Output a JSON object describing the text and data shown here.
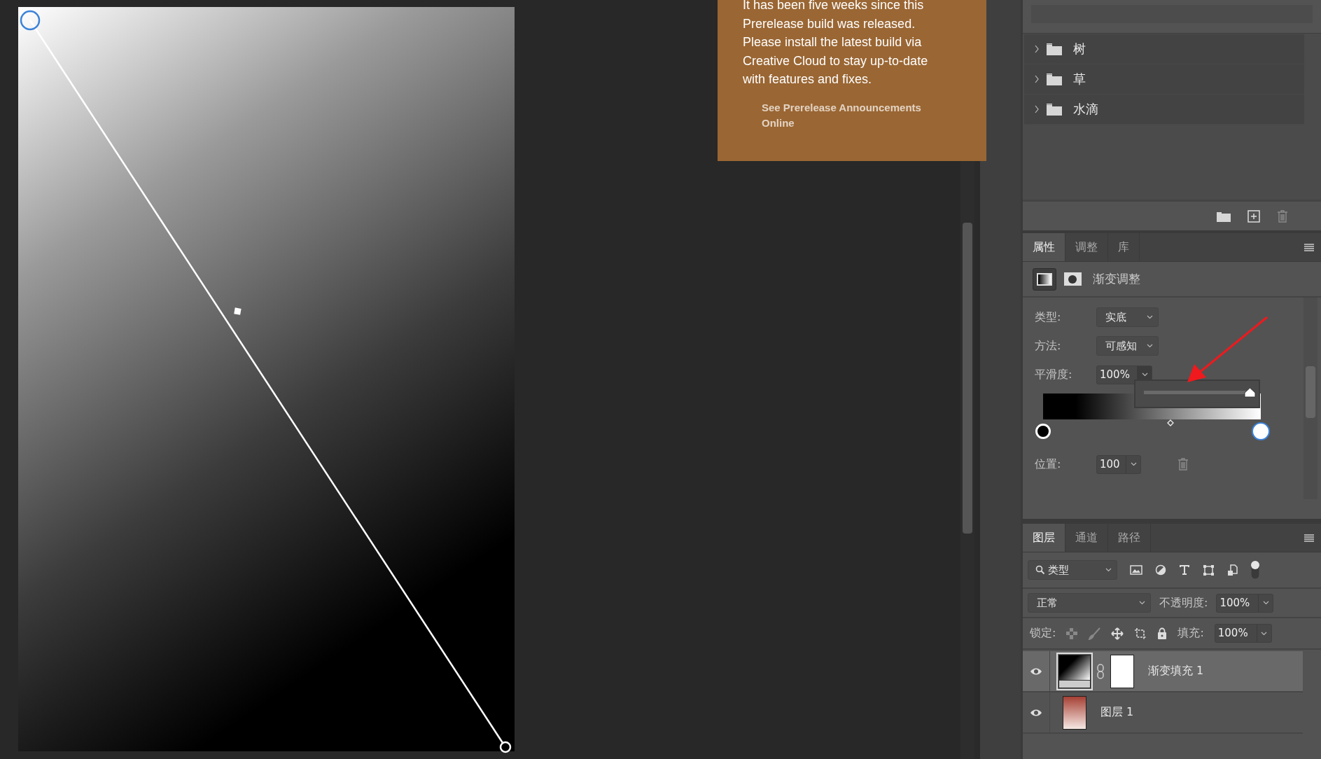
{
  "notification": {
    "message": "It has been five weeks since this Prerelease build was released. Please install the latest build via Creative Cloud to stay up-to-date with features and fixes.",
    "link": "See Prerelease Announcements Online"
  },
  "groups": [
    {
      "name": "树",
      "expanded": false
    },
    {
      "name": "草",
      "expanded": false
    },
    {
      "name": "水滴",
      "expanded": false
    }
  ],
  "properties": {
    "tabs": [
      {
        "label": "属性",
        "selected": true
      },
      {
        "label": "调整",
        "selected": false
      },
      {
        "label": "库",
        "selected": false
      }
    ],
    "modes": [
      {
        "kind": "gradient",
        "selected": true
      },
      {
        "kind": "mask",
        "selected": false
      }
    ],
    "title": "渐变调整",
    "fields": [
      {
        "label": "类型:",
        "value": "实底"
      },
      {
        "label": "方法:",
        "value": "可感知"
      }
    ],
    "smoothness": {
      "label": "平滑度:",
      "value": "100%",
      "level": 1
    },
    "stops": [
      {
        "color": "#000000",
        "selected": false
      },
      {
        "color": "#ffffff",
        "selected": true
      }
    ],
    "position": {
      "label": "位置:",
      "value": "100"
    }
  },
  "layers_panel": {
    "tabs": [
      {
        "label": "图层",
        "selected": true
      },
      {
        "label": "通道",
        "selected": false
      },
      {
        "label": "路径",
        "selected": false
      }
    ],
    "filter": "类型",
    "filter_on": true,
    "blend_mode": "正常",
    "opacity": {
      "label": "不透明度:",
      "value": "100%"
    },
    "lock_label": "锁定:",
    "fill": {
      "label": "填充:",
      "value": "100%"
    },
    "layers": [
      {
        "name": "渐变填充 1",
        "kind": "gradient-fill",
        "visible": true,
        "selected": true
      },
      {
        "name": "图层 1",
        "kind": "pixel",
        "visible": true,
        "selected": false
      }
    ]
  }
}
